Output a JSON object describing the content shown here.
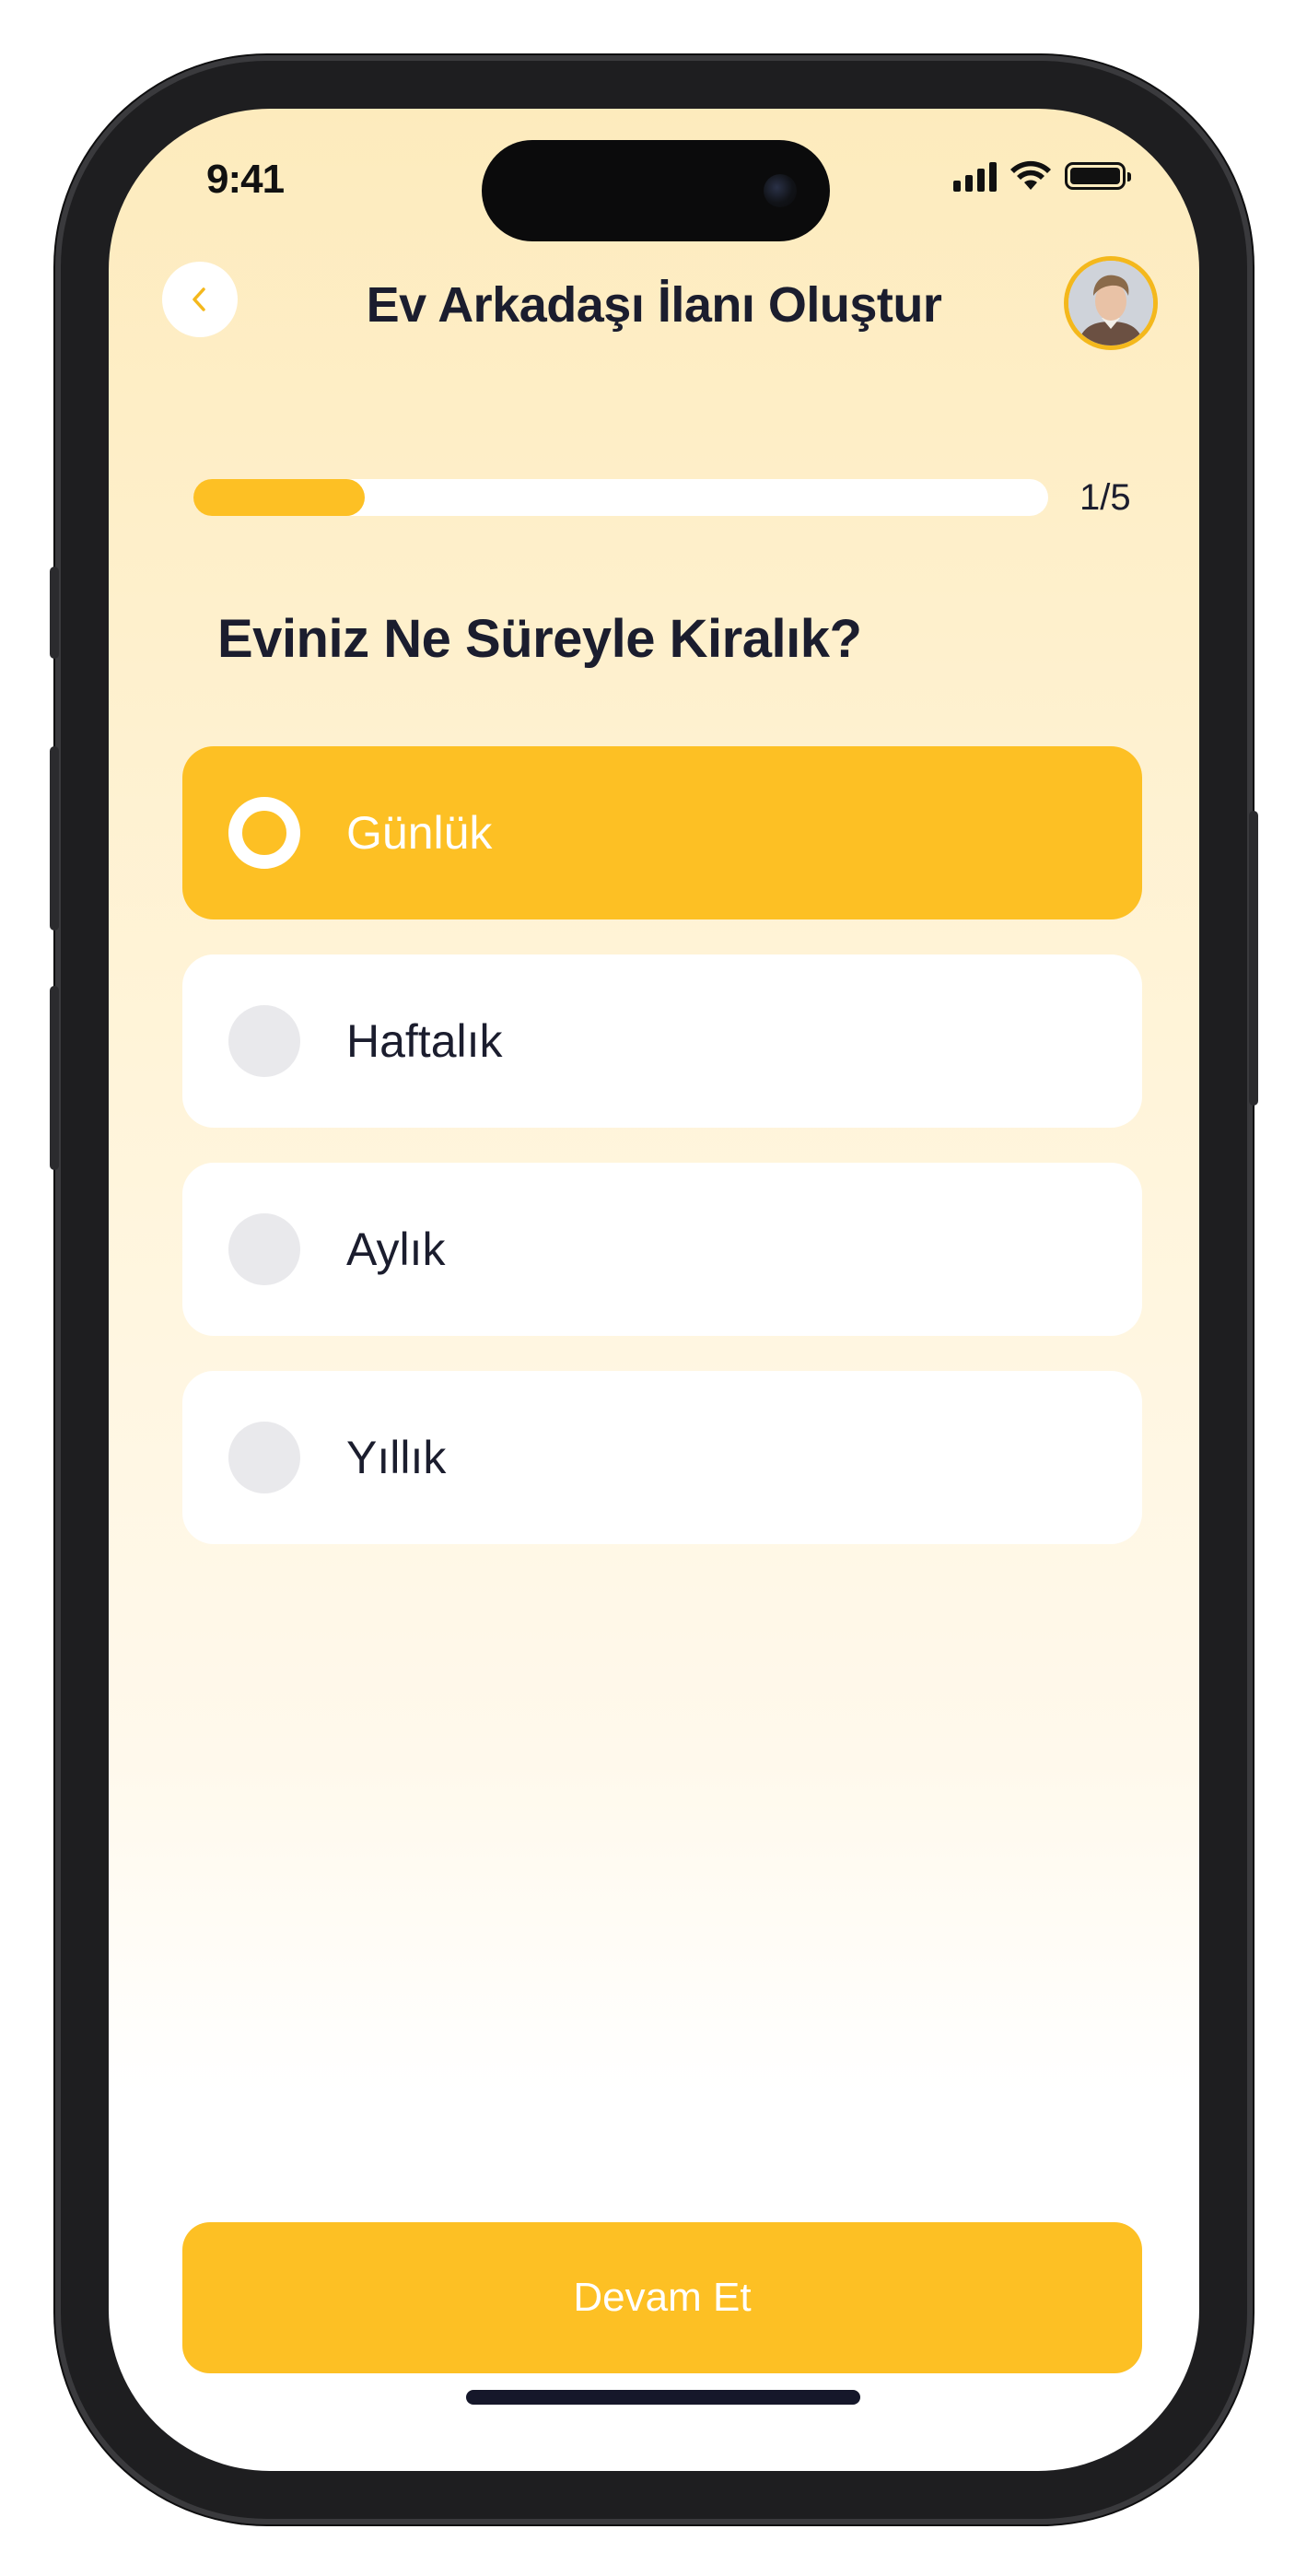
{
  "status_bar": {
    "time": "9:41"
  },
  "header": {
    "title": "Ev Arkadaşı İlanı Oluştur"
  },
  "progress": {
    "label": "1/5",
    "fraction": 0.2
  },
  "question": "Eviniz Ne Süreyle Kiralık?",
  "options": [
    {
      "label": "Günlük",
      "selected": true
    },
    {
      "label": "Haftalık",
      "selected": false
    },
    {
      "label": "Aylık",
      "selected": false
    },
    {
      "label": "Yıllık",
      "selected": false
    }
  ],
  "cta": {
    "label": "Devam Et"
  },
  "colors": {
    "accent": "#fdc024",
    "text": "#1b1d2e",
    "radio_off": "#e9e9ec"
  },
  "icons": {
    "back": "chevron-left-icon",
    "avatar": "user-avatar"
  }
}
